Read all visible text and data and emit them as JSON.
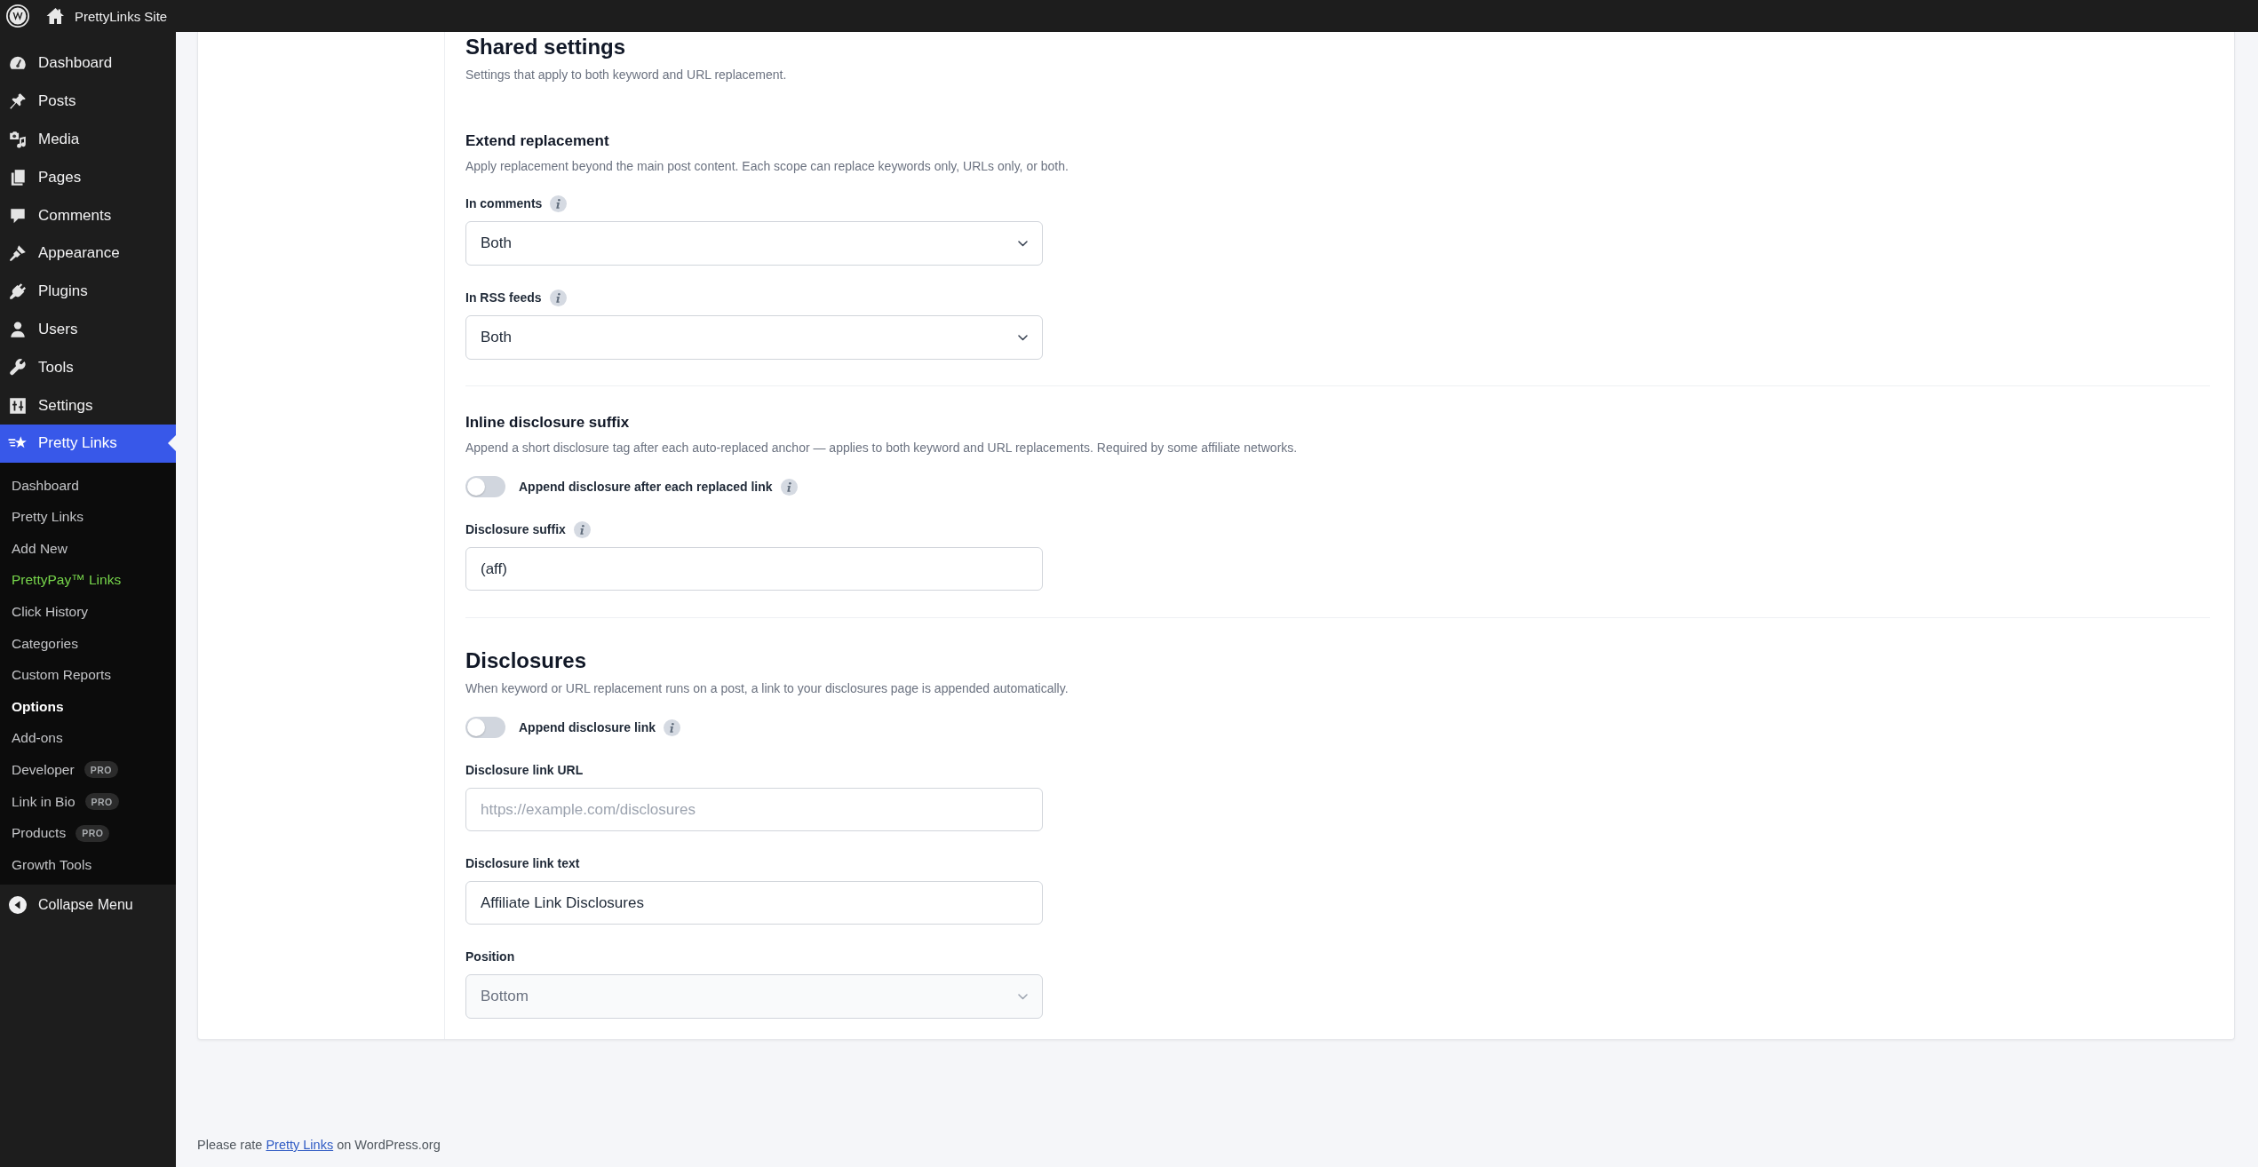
{
  "admin_bar": {
    "site_name": "PrettyLinks Site"
  },
  "sidebar": {
    "items": [
      {
        "label": "Dashboard",
        "selected": false
      },
      {
        "label": "Posts",
        "selected": false
      },
      {
        "label": "Media",
        "selected": false
      },
      {
        "label": "Pages",
        "selected": false
      },
      {
        "label": "Comments",
        "selected": false
      },
      {
        "label": "Appearance",
        "selected": false
      },
      {
        "label": "Plugins",
        "selected": false
      },
      {
        "label": "Users",
        "selected": false
      },
      {
        "label": "Tools",
        "selected": false
      },
      {
        "label": "Settings",
        "selected": false
      },
      {
        "label": "Pretty Links",
        "selected": true,
        "children": [
          {
            "label": "Dashboard",
            "selected": false
          },
          {
            "label": "Pretty Links",
            "selected": false
          },
          {
            "label": "Add New",
            "selected": false
          },
          {
            "label": "PrettyPay™ Links",
            "selected": false,
            "color": "#77d64b"
          },
          {
            "label": "Click History",
            "selected": false
          },
          {
            "label": "Categories",
            "selected": false
          },
          {
            "label": "Custom Reports",
            "selected": false
          },
          {
            "label": "Options",
            "selected": true
          },
          {
            "label": "Add-ons",
            "selected": false
          },
          {
            "label": "Developer",
            "selected": false,
            "badge": "PRO"
          },
          {
            "label": "Link in Bio",
            "selected": false,
            "badge": "PRO"
          },
          {
            "label": "Products",
            "selected": false,
            "badge": "PRO"
          },
          {
            "label": "Growth Tools",
            "selected": false
          }
        ]
      }
    ],
    "collapse_label": "Collapse Menu"
  },
  "content": {
    "sections": [
      {
        "title": "Shared settings",
        "description": "Settings that apply to both keyword and URL replacement.",
        "groups": [
          {
            "title": "Extend replacement",
            "description": "Apply replacement beyond the main post content. Each scope can replace keywords only, URLs only, or both.",
            "fields": [
              {
                "kind": "select",
                "label": "In comments",
                "info": true,
                "value": "Both",
                "disabled": false
              },
              {
                "kind": "select",
                "label": "In RSS feeds",
                "info": true,
                "value": "Both",
                "disabled": false
              }
            ]
          },
          {
            "title": "Inline disclosure suffix",
            "description": "Append a short disclosure tag after each auto-replaced anchor — applies to both keyword and URL replacements. Required by some affiliate networks.",
            "fields": [
              {
                "kind": "toggle",
                "label": "Append disclosure after each replaced link",
                "info": true,
                "on": false
              },
              {
                "kind": "text",
                "label": "Disclosure suffix",
                "info": true,
                "value": "(aff)"
              }
            ]
          }
        ]
      },
      {
        "title": "Disclosures",
        "description": "When keyword or URL replacement runs on a post, a link to your disclosures page is appended automatically.",
        "fields": [
          {
            "kind": "toggle",
            "label": "Append disclosure link",
            "info": true,
            "on": false
          },
          {
            "kind": "text",
            "label": "Disclosure link URL",
            "info": false,
            "placeholder": "https://example.com/disclosures"
          },
          {
            "kind": "text",
            "label": "Disclosure link text",
            "info": false,
            "value": "Affiliate Link Disclosures"
          },
          {
            "kind": "select",
            "label": "Position",
            "info": false,
            "value": "Bottom",
            "disabled": true
          }
        ]
      }
    ]
  },
  "footer": {
    "before": "Please rate",
    "link": "Pretty Links",
    "after": "on WordPress.org"
  }
}
